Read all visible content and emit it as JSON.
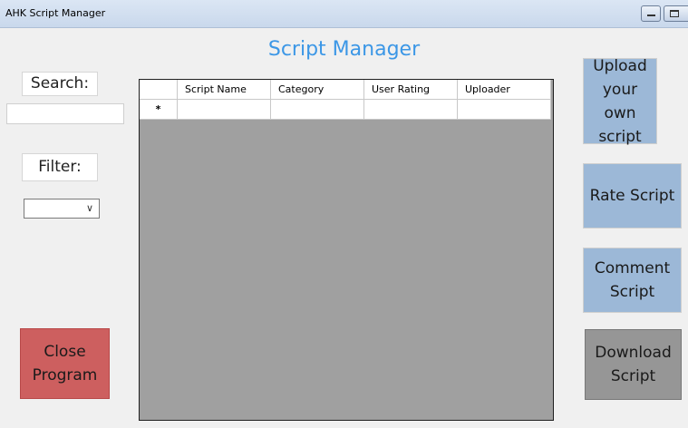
{
  "window": {
    "title": "AHK Script Manager"
  },
  "header": {
    "title": "Script Manager"
  },
  "left_panel": {
    "search_label": "Search:",
    "search_value": "",
    "filter_label": "Filter:",
    "filter_value": "",
    "close_button": "Close Program"
  },
  "table": {
    "columns": [
      "Script Name",
      "Category",
      "User Rating",
      "Uploader"
    ],
    "new_row_marker": "*"
  },
  "right_panel": {
    "upload_button": "Upload your own script",
    "rate_button": "Rate Script",
    "comment_button": "Comment Script",
    "download_button": "Download Script"
  },
  "colors": {
    "heading": "#3c97e6",
    "action_blue": "#9cb8d7",
    "close_red": "#cd5f5f",
    "download_gray": "#969696",
    "grid_background": "#a0a0a0"
  }
}
